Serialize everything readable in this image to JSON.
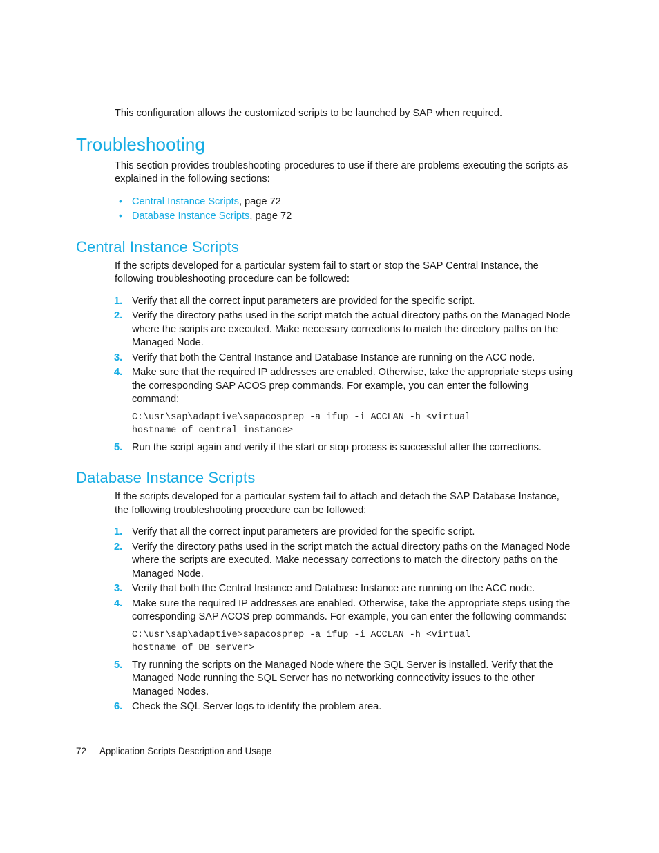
{
  "page": {
    "number": "72",
    "footer_title": "Application Scripts Description and Usage"
  },
  "intro": {
    "paragraph": "This configuration allows the customized scripts to be launched by SAP when required."
  },
  "troubleshooting": {
    "heading": "Troubleshooting",
    "intro": "This section provides troubleshooting procedures to use if there are problems executing the scripts as explained in the following sections:",
    "links": [
      {
        "label": "Central Instance Scripts",
        "suffix": ", page 72"
      },
      {
        "label": "Database Instance Scripts",
        "suffix": ", page 72"
      }
    ]
  },
  "central_instance": {
    "heading": "Central Instance Scripts",
    "intro": "If the scripts developed for a particular system fail to start or stop the SAP Central Instance, the following troubleshooting procedure can be followed:",
    "steps": [
      {
        "num": "1.",
        "text": "Verify that all the correct input parameters are provided for the specific script."
      },
      {
        "num": "2.",
        "text": "Verify the directory paths used in the script match the actual directory paths on the Managed Node where the scripts are executed. Make necessary corrections to match the directory paths on the Managed Node."
      },
      {
        "num": "3.",
        "text": "Verify that both the Central Instance and Database Instance are running on the ACC node."
      },
      {
        "num": "4.",
        "text": "Make sure that the required IP addresses are enabled. Otherwise, take the appropriate steps using the corresponding SAP ACOS prep commands. For example, you can enter the following command:"
      },
      {
        "num": "5.",
        "text": "Run the script again and verify if the start or stop process is successful after the corrections."
      }
    ],
    "code": "C:\\usr\\sap\\adaptive\\sapacosprep -a ifup -i ACCLAN -h <virtual\nhostname of central instance>"
  },
  "database_instance": {
    "heading": "Database Instance Scripts",
    "intro": "If the scripts developed for a particular system fail to attach and detach the SAP Database Instance, the following troubleshooting procedure can be followed:",
    "steps": [
      {
        "num": "1.",
        "text": "Verify that all the correct input parameters are provided for the specific script."
      },
      {
        "num": "2.",
        "text": "Verify the directory paths used in the script match the actual directory paths on the Managed Node where the scripts are executed. Make necessary corrections to match the directory paths on the Managed Node."
      },
      {
        "num": "3.",
        "text": "Verify that both the Central Instance and Database Instance are running on the ACC node."
      },
      {
        "num": "4.",
        "text": "Make sure the required IP addresses are enabled. Otherwise, take the appropriate steps using the corresponding SAP ACOS prep commands. For example, you can enter the following commands:"
      },
      {
        "num": "5.",
        "text": "Try running the scripts on the Managed Node where the SQL Server is installed. Verify that the Managed Node running the SQL Server has no networking connectivity issues to the other Managed Nodes."
      },
      {
        "num": "6.",
        "text": "Check the SQL Server logs to identify the problem area."
      }
    ],
    "code": "C:\\usr\\sap\\adaptive>sapacosprep -a ifup -i ACCLAN -h <virtual\nhostname of DB server>"
  },
  "colors": {
    "heading_accent": "#16ACE3",
    "body_text": "#1a1a1a",
    "code_text": "#232323",
    "page_background": "#ffffff"
  }
}
